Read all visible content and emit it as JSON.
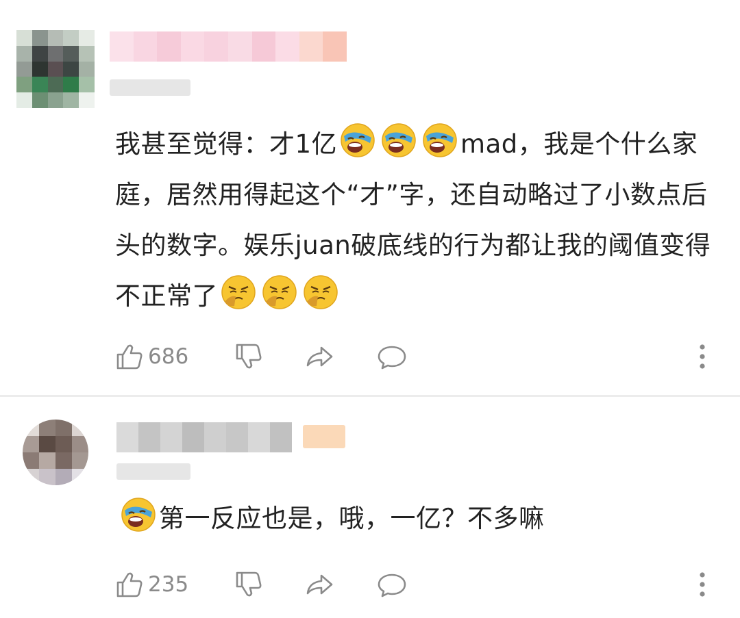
{
  "comments": [
    {
      "text_parts": [
        "我甚至觉得：才1亿",
        "mad，我是个什么家庭，居然用得起这个“才”字，还自动略过了小数点后头的数字。娱乐juan破底线的行为都让我的阈值变得不正常了"
      ],
      "emoji_after_part1": [
        "laugh-cry-emoji",
        "laugh-cry-emoji",
        "laugh-cry-emoji"
      ],
      "emoji_after_part2": [
        "nosepick-emoji",
        "nosepick-emoji",
        "nosepick-emoji"
      ],
      "likes": "686"
    },
    {
      "text": "第一反应也是，哦，一亿？不多嘛",
      "emoji_before": [
        "laugh-cry-emoji"
      ],
      "likes": "235"
    }
  ],
  "colors": {
    "text": "#222222",
    "icon": "#8a8a8a",
    "divider": "#ececec",
    "emoji_yellow": "#f7c531"
  }
}
